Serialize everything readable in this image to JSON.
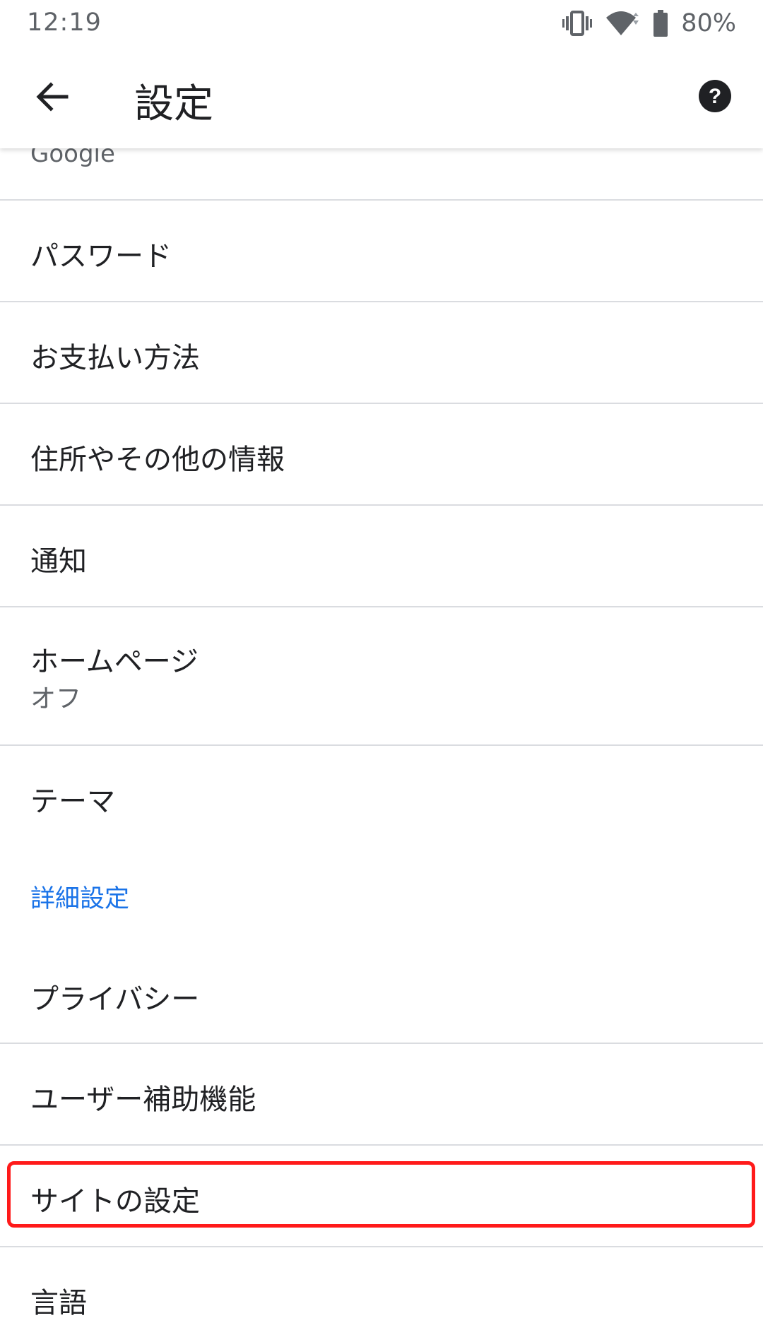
{
  "status_bar": {
    "time": "12:19",
    "battery_percent": "80%",
    "icons": [
      "vibrate-icon",
      "wifi-icon",
      "battery-icon"
    ]
  },
  "app_bar": {
    "title": "設定",
    "back_icon": "arrow-back-icon",
    "help_icon": "help-icon"
  },
  "list": {
    "partial_item_sub": "Google",
    "items": [
      {
        "label": "パスワード"
      },
      {
        "label": "お支払い方法"
      },
      {
        "label": "住所やその他の情報"
      },
      {
        "label": "通知"
      },
      {
        "label": "ホームページ",
        "sub": "オフ"
      },
      {
        "label": "テーマ"
      }
    ],
    "section_header": "詳細設定",
    "advanced_items": [
      {
        "label": "プライバシー"
      },
      {
        "label": "ユーザー補助機能"
      },
      {
        "label": "サイトの設定"
      },
      {
        "label": "言語"
      }
    ]
  },
  "colors": {
    "accent": "#1a73e8",
    "highlight": "#ff1a1a",
    "divider": "#dadce0"
  }
}
